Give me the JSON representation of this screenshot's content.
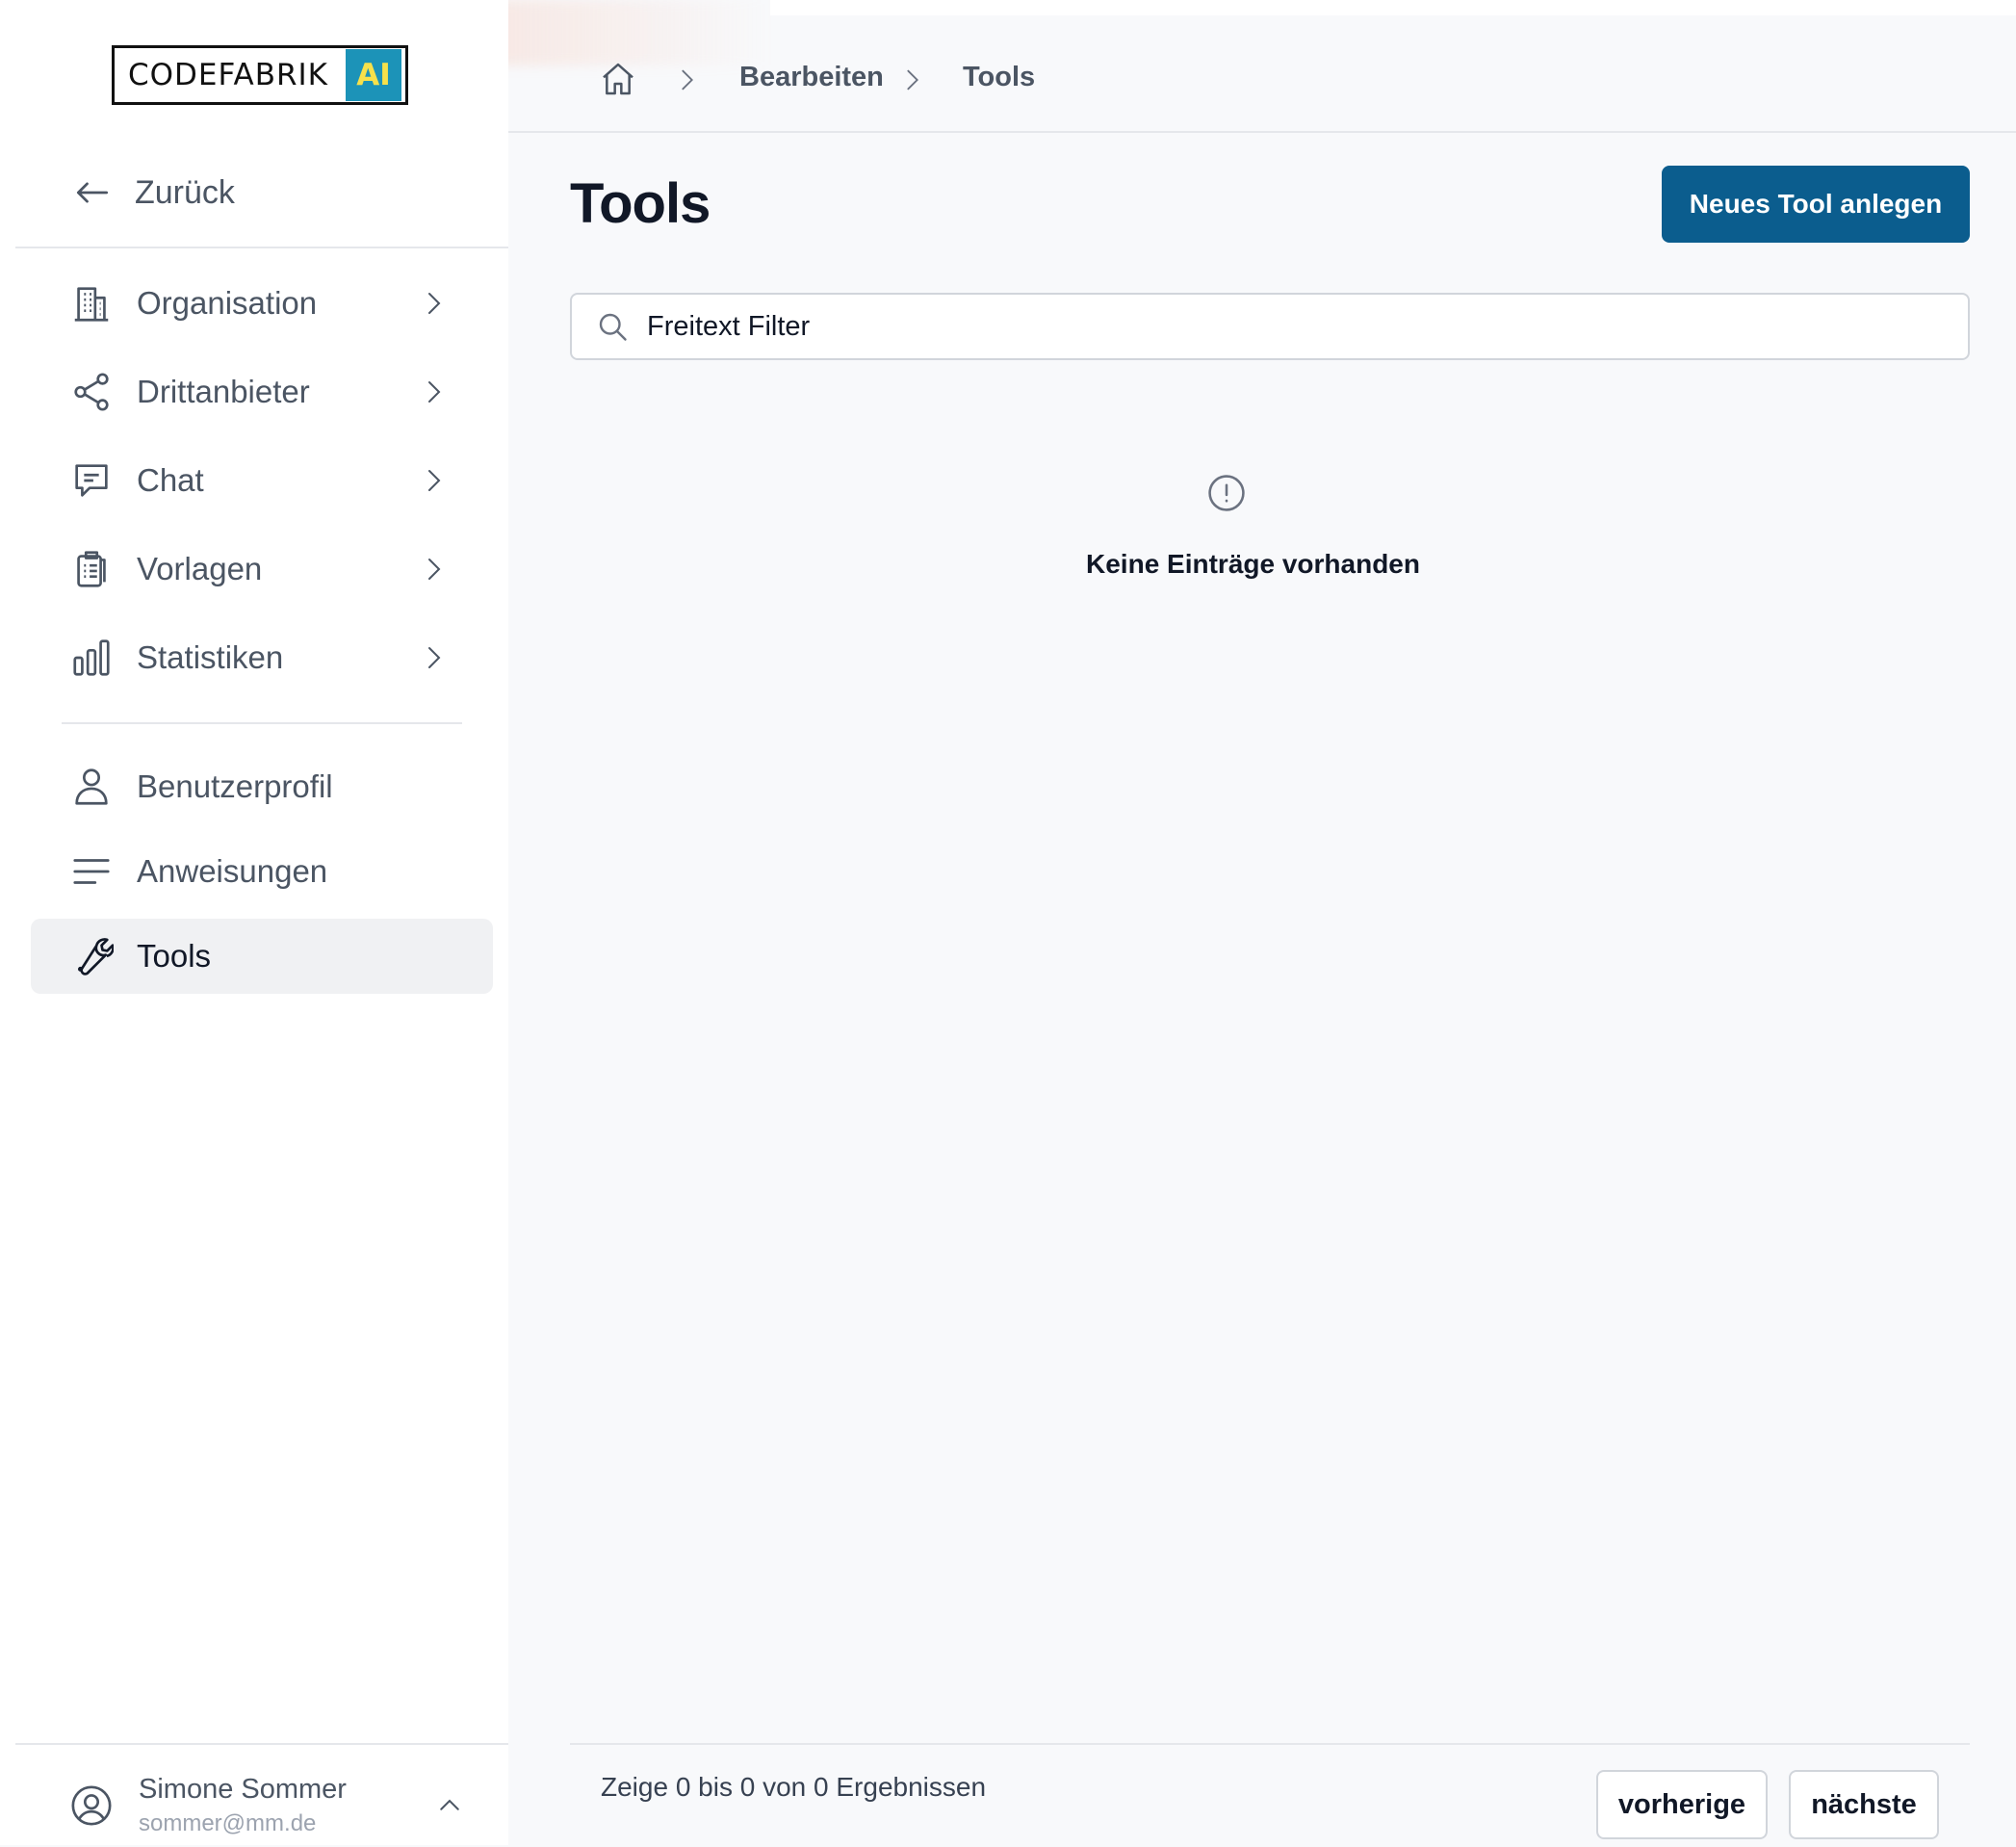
{
  "logo": {
    "brand": "CODEFABRIK",
    "suffix": "AI"
  },
  "sidebar": {
    "back_label": "Zurück",
    "groups": [
      {
        "label": "Organisation",
        "icon": "building-icon"
      },
      {
        "label": "Drittanbieter",
        "icon": "share-icon"
      },
      {
        "label": "Chat",
        "icon": "chat-bubble-icon"
      },
      {
        "label": "Vorlagen",
        "icon": "clipboard-icon"
      },
      {
        "label": "Statistiken",
        "icon": "bar-chart-icon"
      }
    ],
    "links": [
      {
        "label": "Benutzerprofil",
        "icon": "user-icon"
      },
      {
        "label": "Anweisungen",
        "icon": "lines-icon"
      },
      {
        "label": "Tools",
        "icon": "wrench-icon",
        "active": true
      }
    ],
    "user": {
      "name": "Simone Sommer",
      "email": "sommer@mm.de"
    }
  },
  "breadcrumb": {
    "items": [
      "Bearbeiten",
      "Tools"
    ]
  },
  "page": {
    "title": "Tools",
    "new_button": "Neues Tool anlegen",
    "search_placeholder": "Freitext Filter",
    "empty_message": "Keine Einträge vorhanden"
  },
  "pagination": {
    "summary": "Zeige 0 bis 0 von 0 Ergebnissen",
    "prev": "vorherige",
    "next": "nächste"
  },
  "colors": {
    "primary": "#0b5d8e",
    "logo_ai_bg": "#1c93b8",
    "logo_ai_text": "#f6e14b"
  }
}
